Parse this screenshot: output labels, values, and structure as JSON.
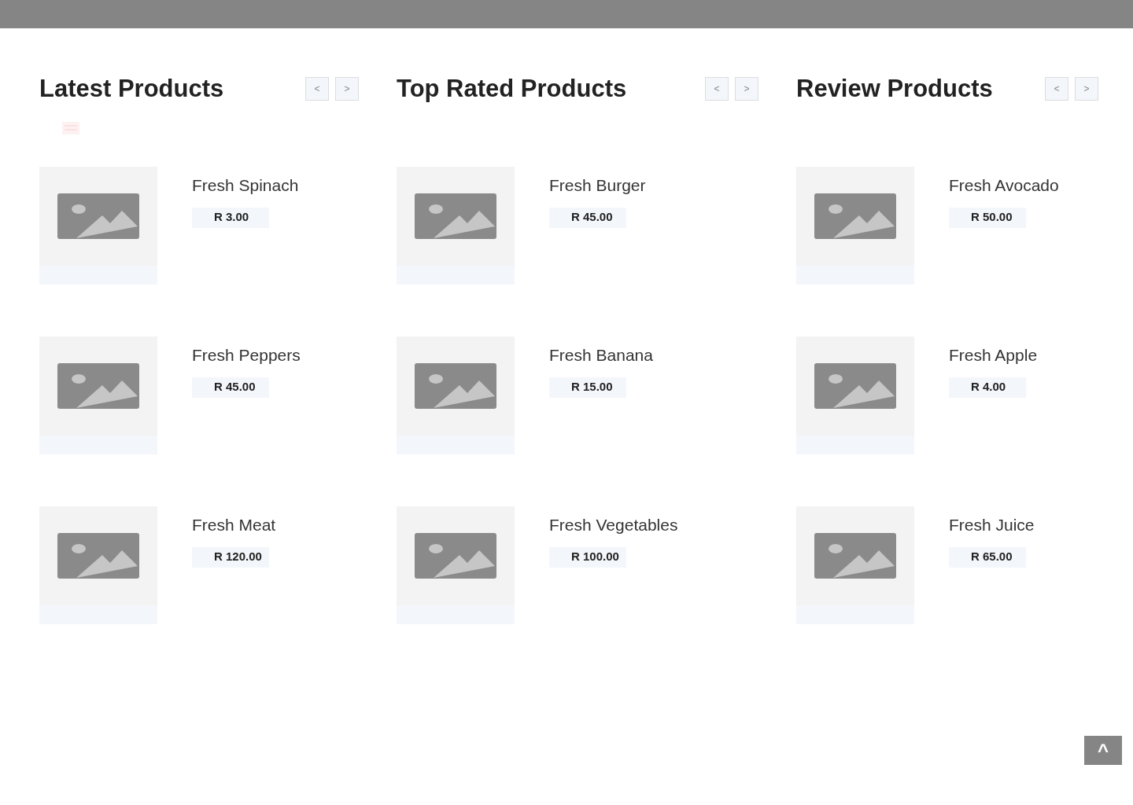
{
  "sections": [
    {
      "title": "Latest Products",
      "prev": "<",
      "next": ">",
      "products": [
        {
          "name": "Fresh Spinach",
          "price": "R 3.00"
        },
        {
          "name": "Fresh Peppers",
          "price": "R 45.00"
        },
        {
          "name": "Fresh Meat",
          "price": "R 120.00"
        }
      ]
    },
    {
      "title": "Top Rated Products",
      "prev": "<",
      "next": ">",
      "products": [
        {
          "name": "Fresh Burger",
          "price": "R 45.00"
        },
        {
          "name": "Fresh Banana",
          "price": "R 15.00"
        },
        {
          "name": "Fresh Vegetables",
          "price": "R 100.00"
        }
      ]
    },
    {
      "title": "Review Products",
      "prev": "<",
      "next": ">",
      "products": [
        {
          "name": "Fresh Avocado",
          "price": "R 50.00"
        },
        {
          "name": "Fresh Apple",
          "price": "R 4.00"
        },
        {
          "name": "Fresh Juice",
          "price": "R 65.00"
        }
      ]
    }
  ],
  "scroll_top": "^"
}
